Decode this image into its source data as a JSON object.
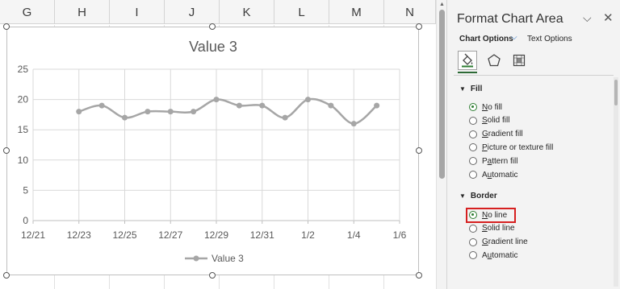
{
  "columns": [
    "G",
    "H",
    "I",
    "J",
    "K",
    "L",
    "M",
    "N"
  ],
  "chart_data": {
    "type": "line",
    "title": "Value 3",
    "x_ticks": [
      "12/21",
      "12/23",
      "12/25",
      "12/27",
      "12/29",
      "12/31",
      "1/2",
      "1/4",
      "1/6"
    ],
    "y_ticks": [
      "0",
      "5",
      "10",
      "15",
      "20",
      "25"
    ],
    "ylim": [
      0,
      25
    ],
    "xlim": [
      "2023-12-21",
      "2024-01-06"
    ],
    "series": [
      {
        "name": "Value 3",
        "color": "#a6a6a6",
        "x": [
          "2023-12-23",
          "2023-12-24",
          "2023-12-25",
          "2023-12-26",
          "2023-12-27",
          "2023-12-28",
          "2023-12-29",
          "2023-12-30",
          "2023-12-31",
          "2024-01-01",
          "2024-01-02",
          "2024-01-03",
          "2024-01-04",
          "2024-01-05"
        ],
        "values": [
          18,
          19,
          17,
          18,
          18,
          18,
          20,
          19,
          19,
          17,
          20,
          19,
          16,
          19
        ]
      }
    ],
    "grid": true,
    "legend": "bottom"
  },
  "pane": {
    "title": "Format Chart Area",
    "tabs": {
      "chart_options": "Chart Options",
      "text_options": "Text Options"
    },
    "fill": {
      "header": "Fill",
      "options": [
        {
          "pre": "",
          "key": "N",
          "post": "o fill",
          "checked": true
        },
        {
          "pre": "",
          "key": "S",
          "post": "olid fill",
          "checked": false
        },
        {
          "pre": "",
          "key": "G",
          "post": "radient fill",
          "checked": false
        },
        {
          "pre": "",
          "key": "P",
          "post": "icture or texture fill",
          "checked": false
        },
        {
          "pre": "P",
          "key": "a",
          "post": "ttern fill",
          "checked": false
        },
        {
          "pre": "A",
          "key": "u",
          "post": "tomatic",
          "checked": false
        }
      ]
    },
    "border": {
      "header": "Border",
      "options": [
        {
          "pre": "",
          "key": "N",
          "post": "o line",
          "checked": true
        },
        {
          "pre": "",
          "key": "S",
          "post": "olid line",
          "checked": false
        },
        {
          "pre": "",
          "key": "G",
          "post": "radient line",
          "checked": false
        },
        {
          "pre": "A",
          "key": "u",
          "post": "tomatic",
          "checked": false
        }
      ]
    }
  },
  "colors": {
    "accent": "#2e7d32",
    "highlight": "#d62020",
    "series": "#a6a6a6"
  }
}
